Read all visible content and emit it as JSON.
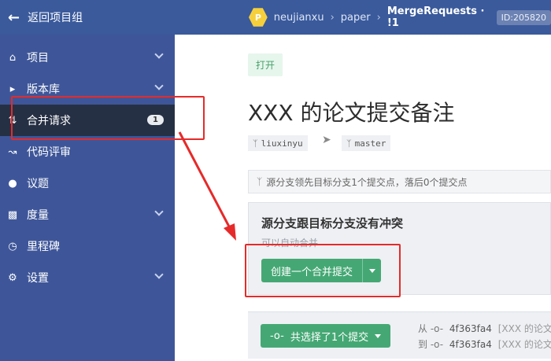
{
  "topbar": {
    "back_label": "返回项目组",
    "avatar_letter": "P",
    "crumbs": [
      "neujianxu",
      "paper",
      "MergeRequests · !1"
    ],
    "id_badge": "ID:205820"
  },
  "sidebar": {
    "items": [
      {
        "label": "项目",
        "icon": "home-icon"
      },
      {
        "label": "版本库",
        "icon": "folder-icon"
      },
      {
        "label": "合并请求",
        "icon": "merge-request-icon",
        "badge": "1"
      },
      {
        "label": "代码评审",
        "icon": "code-review-icon"
      },
      {
        "label": "议题",
        "icon": "issue-icon"
      },
      {
        "label": "度量",
        "icon": "chart-icon"
      },
      {
        "label": "里程碑",
        "icon": "clock-icon"
      },
      {
        "label": "设置",
        "icon": "gear-icon"
      }
    ]
  },
  "mr": {
    "status": "打开",
    "title": "XXX 的论文提交备注",
    "source_branch": "liuxinyu",
    "target_branch": "master",
    "commit_note": "源分支领先目标分支1个提交点，落后0个提交点",
    "merge_heading": "源分支跟目标分支没有冲突",
    "merge_sub": "可以自动合并",
    "merge_button": "创建一个合并提交",
    "commits_button": "共选择了1个提交",
    "from_label": "从",
    "to_label": "到",
    "from_sha": "4f363fa4",
    "to_sha": "4f363fa4",
    "commit_msg": "[XXX 的论文提"
  },
  "colors": {
    "topbar": "#3a5a9c",
    "sidebar": "#3e5699",
    "active_item": "#263044",
    "primary_green": "#45a874",
    "annotation_red": "#e62a2a"
  }
}
